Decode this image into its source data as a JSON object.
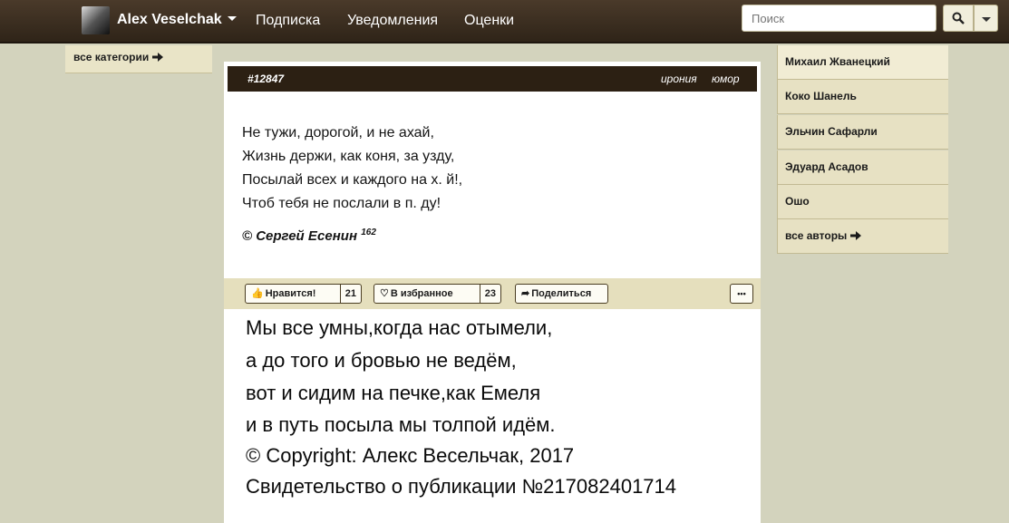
{
  "navbar": {
    "user_name": "Alex Veselchak",
    "links": [
      "Подписка",
      "Уведомления",
      "Оценки"
    ],
    "search_placeholder": "Поиск",
    "search_icon": "search-icon",
    "dropdown_icon": "caret-down-icon"
  },
  "categories": {
    "link": "все категории",
    "icon": "arrow-right-icon"
  },
  "quote": {
    "id": "#12847",
    "tags": [
      "ирония",
      "юмор"
    ],
    "lines": [
      "Не тужи, дорогой, и не ахай,",
      "Жизнь держи, как коня, за узду,",
      "Посылай всех и каждого на х. й!,",
      "Чтоб тебя не послали в п. ду!"
    ],
    "author": "© Сергей Есенин",
    "author_count": "162"
  },
  "actions": {
    "like_label": "Нравится!",
    "like_count": "21",
    "favorite_label": "В избранное",
    "favorite_count": "23",
    "share_label": "Поделиться",
    "more_label": "•••"
  },
  "pasted_text": {
    "lines": [
      "Мы все умны,когда нас отымели,",
      "а до того и бровью не ведём,",
      "вот  и сидим на печке,как Емеля",
      "и в путь посыла мы толпой идём.",
      "© Copyright: Алекс Весельчак, 2017",
      "Свидетельство о публикации №217082401714"
    ]
  },
  "authors": {
    "items": [
      "Михаил Жванецкий",
      "Коко Шанель",
      "Эльчин Сафарли",
      "Эдуард Асадов",
      "Ошо"
    ],
    "more_link": "все авторы"
  },
  "colors": {
    "navbar": "#2f2418",
    "background": "#d3d3bd",
    "card_header": "#2c2013",
    "action_bar": "#e5dfbd"
  }
}
